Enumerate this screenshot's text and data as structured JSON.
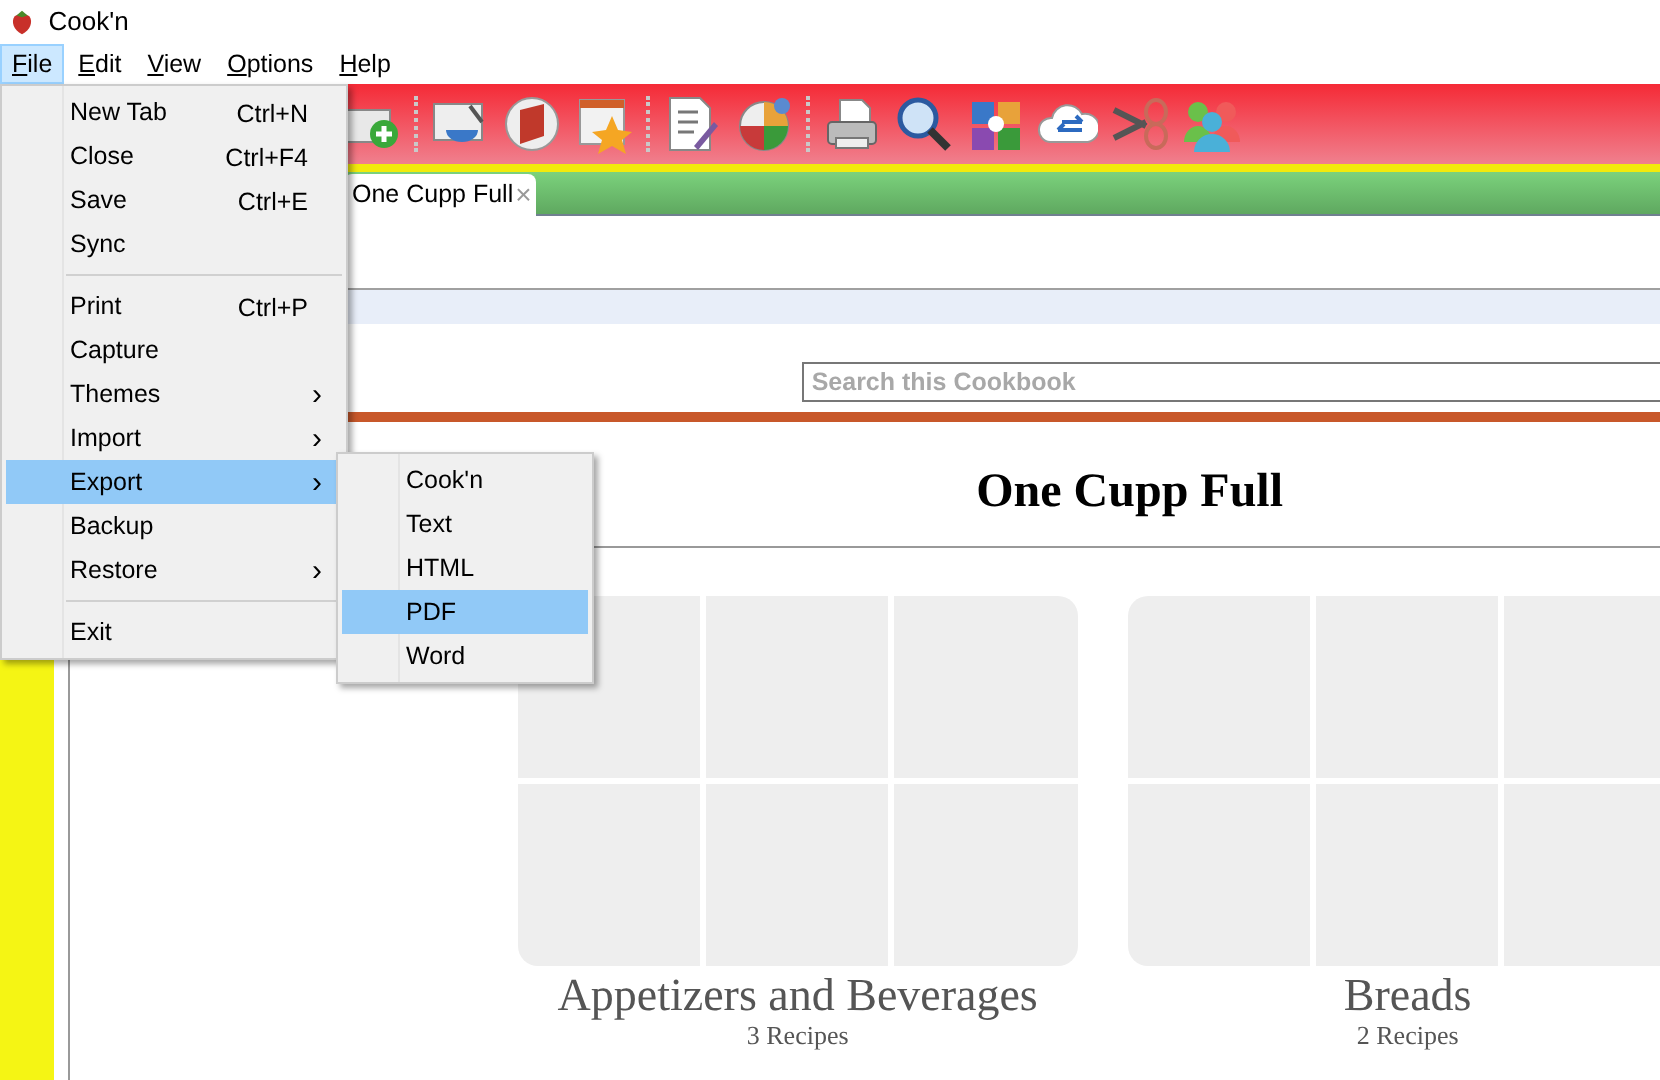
{
  "window": {
    "title": "Cook'n"
  },
  "menubar": [
    {
      "label": "File",
      "selected": true
    },
    {
      "label": "Edit",
      "selected": false
    },
    {
      "label": "View",
      "selected": false
    },
    {
      "label": "Options",
      "selected": false
    },
    {
      "label": "Help",
      "selected": false
    }
  ],
  "file_menu": {
    "items": [
      {
        "kind": "item",
        "label": "New Tab",
        "shortcut": "Ctrl+N",
        "selected": false
      },
      {
        "kind": "item",
        "label": "Close",
        "shortcut": "Ctrl+F4",
        "selected": false
      },
      {
        "kind": "item",
        "label": "Save",
        "shortcut": "Ctrl+E",
        "selected": false
      },
      {
        "kind": "item",
        "label": "Sync",
        "selected": false
      },
      {
        "kind": "separator"
      },
      {
        "kind": "item",
        "label": "Print",
        "shortcut": "Ctrl+P",
        "selected": false
      },
      {
        "kind": "item",
        "label": "Capture",
        "selected": false
      },
      {
        "kind": "submenu",
        "label": "Themes",
        "arrow": "›",
        "selected": false
      },
      {
        "kind": "submenu",
        "label": "Import",
        "arrow": "›",
        "selected": false
      },
      {
        "kind": "submenu",
        "label": "Export",
        "arrow": "›",
        "selected": true
      },
      {
        "kind": "item",
        "label": "Backup",
        "selected": false
      },
      {
        "kind": "submenu",
        "label": "Restore",
        "arrow": "›",
        "selected": false
      },
      {
        "kind": "separator"
      },
      {
        "kind": "item",
        "label": "Exit",
        "selected": false
      }
    ]
  },
  "export_submenu": {
    "items": [
      {
        "label": "Cook'n",
        "selected": false
      },
      {
        "label": "Text",
        "selected": false
      },
      {
        "label": "HTML",
        "selected": false
      },
      {
        "label": "PDF",
        "selected": true
      },
      {
        "label": "Word",
        "selected": false
      }
    ]
  },
  "tabs": [
    {
      "label": "One Cupp Full",
      "close": "×",
      "selected": true
    }
  ],
  "search": {
    "placeholder": "Search this Cookbook"
  },
  "cookbook": {
    "title": "One Cupp Full",
    "categories": [
      {
        "name": "Appetizers and Beverages",
        "count": "3 Recipes"
      },
      {
        "name": "Breads",
        "count": "2 Recipes"
      }
    ]
  }
}
